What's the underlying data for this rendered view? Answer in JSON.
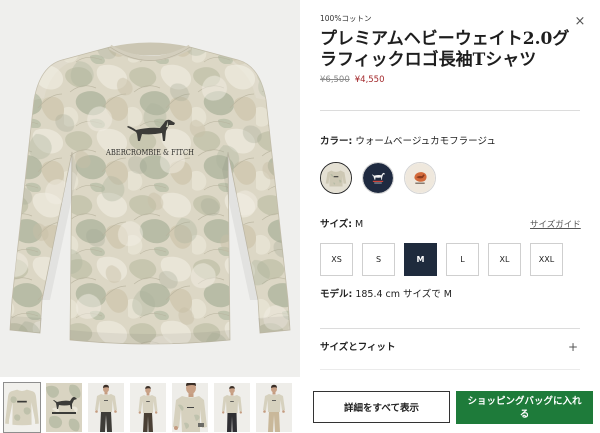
{
  "product": {
    "material": "100%コットン",
    "title": "プレミアムヘビーウェイト2.0グラフィックロゴ長袖Tシャツ",
    "original_price": "¥6,500",
    "sale_price": "¥4,550"
  },
  "close": {
    "glyph": "×",
    "icon": "close-icon"
  },
  "color": {
    "label": "カラー:",
    "value": "ウォームベージュカモフラージュ",
    "swatches": [
      {
        "color": "#e4e0d3",
        "selected": true
      },
      {
        "color": "#1f2a40",
        "selected": false
      },
      {
        "color": "#efe8dd",
        "selected": false
      }
    ]
  },
  "size": {
    "label": "サイズ:",
    "selected": "M",
    "guide_label": "サイズガイド",
    "options": [
      "XS",
      "S",
      "M",
      "L",
      "XL",
      "XXL"
    ]
  },
  "model": {
    "label": "モデル:",
    "value": "185.4 cm サイズで M"
  },
  "accordion": {
    "label": "サイズとフィット",
    "glyph": "+",
    "icon": "plus-icon"
  },
  "actions": {
    "details_label": "詳細をすべて表示",
    "add_to_bag_label": "ショッピングバッグに入れる"
  },
  "product_image": {
    "logo_text": "ABERCROMBIE & FITCH"
  },
  "gallery": {
    "selected_thumbnail": 1
  },
  "theme": {
    "sale_price": "#a3282b",
    "selected_size_bg": "#1f2b3d",
    "add_to_bag_bg": "#1e7b3a"
  }
}
